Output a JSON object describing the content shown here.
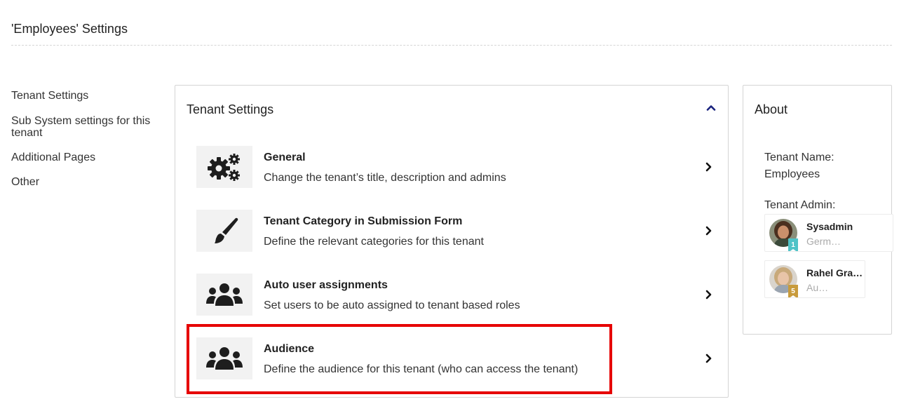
{
  "header": {
    "title": "'Employees' Settings"
  },
  "sidebar": {
    "items": [
      {
        "label": "Tenant Settings"
      },
      {
        "label": "Sub System settings for this tenant"
      },
      {
        "label": "Additional Pages"
      },
      {
        "label": "Other"
      }
    ]
  },
  "panel": {
    "title": "Tenant Settings",
    "items": [
      {
        "icon": "gears-icon",
        "title": "General",
        "description": "Change the tenant’s title, description and admins"
      },
      {
        "icon": "paintbrush-icon",
        "title": "Tenant Category in Submission Form",
        "description": "Define the relevant categories for this tenant"
      },
      {
        "icon": "users-group-icon",
        "title": "Auto user assignments",
        "description": "Set users to be auto assigned to tenant based roles"
      },
      {
        "icon": "users-group-icon",
        "title": "Audience",
        "description": "Define the audience for this tenant (who can access the tenant)"
      }
    ]
  },
  "about": {
    "title": "About",
    "tenant_name_label": "Tenant Name:",
    "tenant_name_value": "Employees",
    "tenant_admin_label": "Tenant Admin:",
    "admins": [
      {
        "name": "Sysadmin",
        "subtitle": "Germ…",
        "badge": "1",
        "badge_color": "#4fc3c7"
      },
      {
        "name": "Rahel Gra…",
        "subtitle": "Au…",
        "badge": "5",
        "badge_color": "#c89b3c"
      }
    ]
  },
  "colors": {
    "accent": "#1a237e",
    "highlight": "#e60000"
  }
}
